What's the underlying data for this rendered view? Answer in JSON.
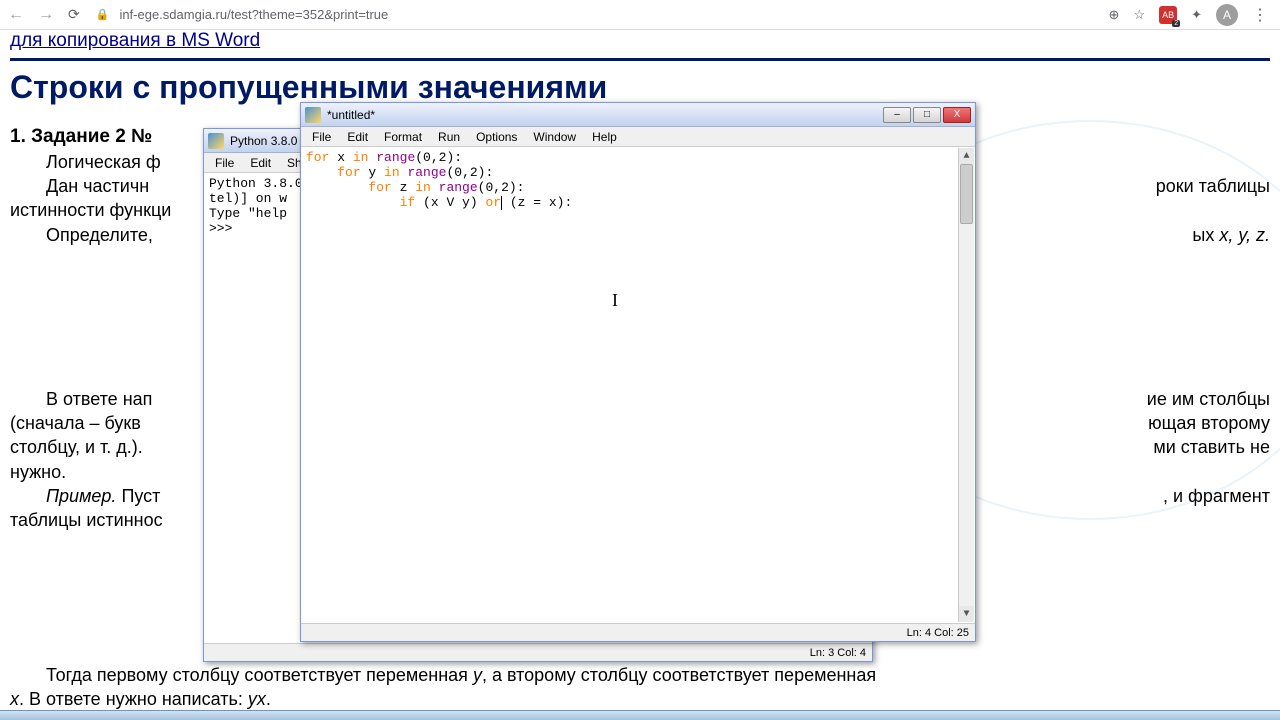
{
  "browser": {
    "url": "inf-ege.sdamgia.ru/test?theme=352&print=true",
    "back_aria": "Back",
    "forward_aria": "Forward",
    "reload_aria": "Reload",
    "lock_aria": "Secure",
    "zoom_icon": "⊕",
    "star_icon": "☆",
    "ext_label": "АВ",
    "ext_badge": "2",
    "puzzle_icon": "✦",
    "avatar_letter": "A",
    "menu_icon": "⋮"
  },
  "page": {
    "top_link": "для копирования в MS Word",
    "big_title": "Строки с пропущенными значениями",
    "task_number": "1. Задание 2 №",
    "line1": "Логическая ф",
    "line2a": "Дан  частичн",
    "line2b": "роки  таблицы",
    "line3a": "истинности функци",
    "line4a": "Определите,",
    "line4b": "ых ",
    "vars": "x, y, z.",
    "p2a": "В ответе нап",
    "p2b": "ие им столбцы",
    "p3a": "(сначала – букв",
    "p3b": "ющая второму",
    "p4a": "столбцу, и т. д.).",
    "p4b": "ми ставить не",
    "p5": "нужно.",
    "p6a": "Пример.",
    "p6b": " Пуст",
    "p6c": ", и фрагмент",
    "p7": "таблицы истиннос",
    "bottom1a": "Тогда первому столбцу соответствует переменная ",
    "bottom1b": "y",
    "bottom1c": ", а второму столбцу соответствует переменная",
    "bottom2a": "x",
    "bottom2b": ". В ответе нужно написать: ",
    "bottom2c": "yx",
    "bottom2d": "."
  },
  "shell_window": {
    "title": "Python 3.8.0",
    "menu": {
      "file": "File",
      "edit": "Edit",
      "shell": "She"
    },
    "content_line1": "Python 3.8.0",
    "content_line2": "tel)] on w",
    "content_line3": "Type \"help",
    "prompt": ">>> ",
    "status": "Ln: 3  Col: 4"
  },
  "editor_window": {
    "title": "*untitled*",
    "menu": {
      "file": "File",
      "edit": "Edit",
      "format": "Format",
      "run": "Run",
      "options": "Options",
      "window": "Window",
      "help": "Help"
    },
    "code": {
      "l1_for": "for",
      "l1_rest1": " x ",
      "l1_in": "in",
      "l1_rest2": " ",
      "l1_range": "range",
      "l1_args": "(0,2):",
      "l2_for": "for",
      "l2_rest1": " y ",
      "l2_in": "in",
      "l2_rest2": " ",
      "l2_range": "range",
      "l2_args": "(0,2):",
      "l3_for": "for",
      "l3_rest1": " z ",
      "l3_in": "in",
      "l3_rest2": " ",
      "l3_range": "range",
      "l3_args": "(0,2):",
      "l4_if": "if",
      "l4_mid1": " (x V y) ",
      "l4_or": "or",
      "l4_mid2": " (z = x):"
    },
    "status": "Ln: 4  Col: 25"
  },
  "win_buttons": {
    "min": "–",
    "max": "□",
    "close": "X"
  }
}
